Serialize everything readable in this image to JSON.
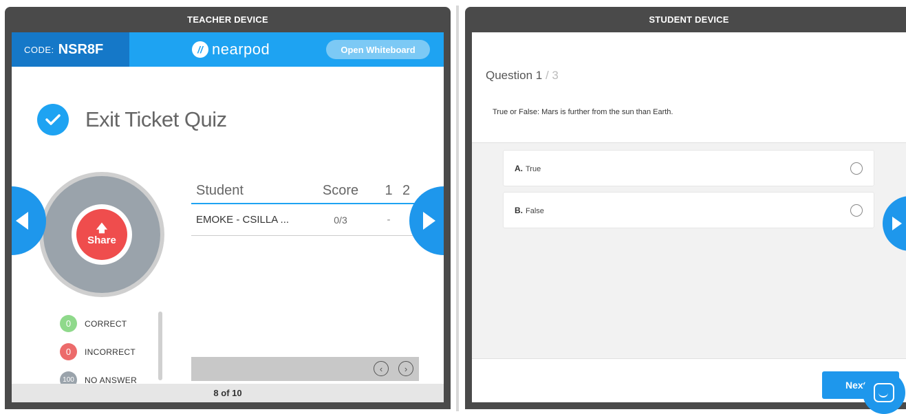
{
  "teacher": {
    "header": "TEACHER DEVICE",
    "code_label": "CODE:",
    "code_value": "NSR8F",
    "logo_text": "nearpod",
    "whiteboard_label": "Open Whiteboard",
    "quiz_title": "Exit Ticket Quiz",
    "share_label": "Share",
    "legend": [
      {
        "count": "0",
        "label": "CORRECT",
        "color": "#8fd98b"
      },
      {
        "count": "0",
        "label": "INCORRECT",
        "color": "#ec6b6b"
      },
      {
        "count": "100",
        "label": "NO ANSWER",
        "color": "#9aa3ab"
      }
    ],
    "table": {
      "headers": {
        "student": "Student",
        "score": "Score",
        "q1": "1",
        "q2": "2"
      },
      "rows": [
        {
          "student": "EMOKE - CSILLA ...",
          "score": "0/3",
          "q1": "-"
        }
      ]
    },
    "pagination": "8 of 10"
  },
  "student": {
    "header": "STUDENT DEVICE",
    "question_label": "Question 1",
    "question_total": " / 3",
    "question_text": "True or False: Mars is further from the sun than Earth.",
    "options": [
      {
        "letter": "A.",
        "text": "True"
      },
      {
        "letter": "B.",
        "text": "False"
      }
    ],
    "next_label": "Next"
  },
  "colors": {
    "brand_blue": "#1ea3f2",
    "code_blue": "#1578c8",
    "frame_gray": "#4a4a4a",
    "share_red": "#ef4d4d"
  }
}
